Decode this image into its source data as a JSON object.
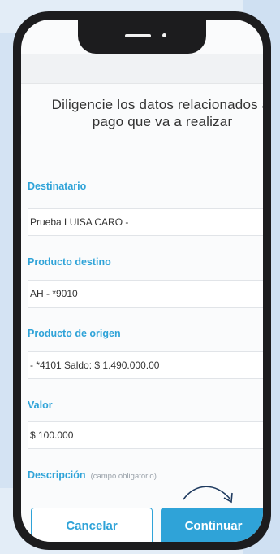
{
  "screen": {
    "heading": "Diligencie los datos relacionados al pago que va a realizar"
  },
  "form": {
    "destinatario": {
      "label": "Destinatario",
      "value": "Prueba LUISA CARO -"
    },
    "producto_destino": {
      "label": "Producto destino",
      "value": "AH - *9010"
    },
    "producto_origen": {
      "label": "Producto de origen",
      "value": "- *4101 Saldo: $ 1.490.000.00"
    },
    "valor": {
      "label": "Valor",
      "value": "$ 100.000"
    },
    "descripcion": {
      "label": "Descripción",
      "hint": "(campo obligatorio)"
    }
  },
  "buttons": {
    "cancel_label": "Cancelar",
    "continue_label": "Continuar"
  },
  "colors": {
    "accent": "#2fa3d8",
    "phone_frame": "#1c1c1e",
    "background": "#e3edf7"
  },
  "icons": {
    "arrow": "curved-arrow-icon"
  }
}
